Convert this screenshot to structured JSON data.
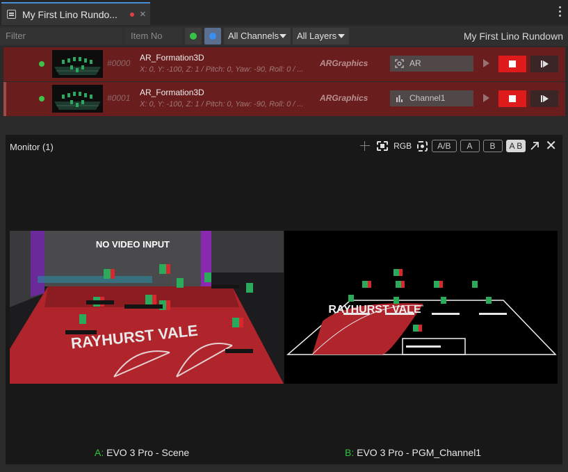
{
  "tab": {
    "title": "My First Lino Rundo...",
    "close": "×"
  },
  "filter": {
    "filter_placeholder": "Filter",
    "itemno_placeholder": "Item No",
    "channels": "All Channels",
    "layers": "All Layers",
    "rundown_name": "My First Lino Rundown"
  },
  "rows": [
    {
      "num": "#0000",
      "name": "AR_Formation3D",
      "params": "X: 0, Y: -100, Z: 1 / Pitch: 0, Yaw: -90, Roll: 0 / ...",
      "plugin": "ARGraphics",
      "channel": "AR",
      "channel_icon": "ar-scan-icon"
    },
    {
      "num": "#0001",
      "name": "AR_Formation3D",
      "params": "X: 0, Y: -100, Z: 1 / Pitch: 0, Yaw: -90, Roll: 0 / ...",
      "plugin": "ARGraphics",
      "channel": "Channel1",
      "channel_icon": "bar-chart-icon"
    }
  ],
  "monitor": {
    "title": "Monitor (1)",
    "tools": {
      "rgb": "RGB",
      "ab_split": "A/B",
      "a": "A",
      "b": "B",
      "a_active": "A",
      "b_active": "B"
    },
    "view_a_text": "NO VIDEO INPUT",
    "view_a_banner": "RAYHURST VALE",
    "view_b_banner": "RAYHURST VALE",
    "label_a_letter": "A:",
    "label_a": " EVO 3 Pro - Scene",
    "label_b_letter": "B:",
    "label_b": " EVO 3 Pro - PGM_Channel1"
  },
  "colors": {
    "row_bg": "#6a1d1d",
    "status_green": "#3ec24a",
    "stop_red": "#e01b1b",
    "accent_blue": "#3a8ff0",
    "label_green": "#2fc43e"
  }
}
